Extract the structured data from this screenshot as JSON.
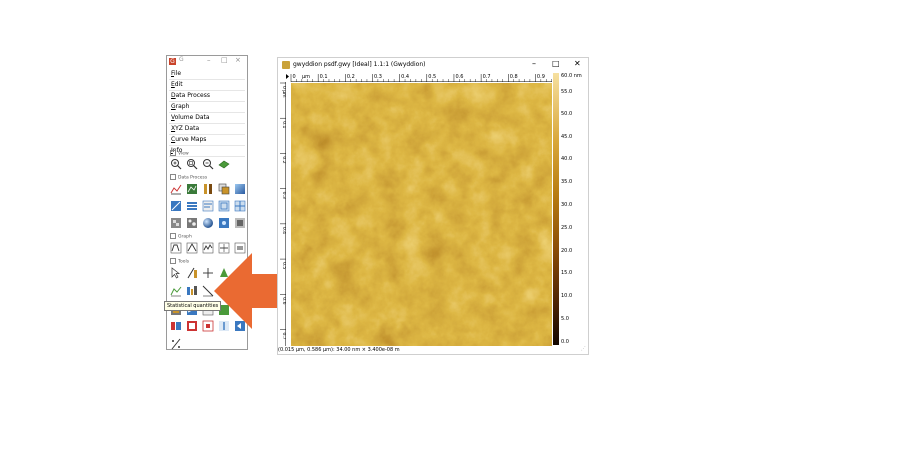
{
  "toolbox": {
    "app_icon": "gwyddion-logo-icon",
    "title": "G",
    "controls": [
      "–",
      "□",
      "×"
    ],
    "menu": [
      {
        "label": "File"
      },
      {
        "label": "Edit"
      },
      {
        "label": "Data Process"
      },
      {
        "label": "Graph"
      },
      {
        "label": "Volume Data"
      },
      {
        "label": "XYZ Data"
      },
      {
        "label": "Curve Maps"
      },
      {
        "label": "Info"
      }
    ],
    "sections": {
      "view": "View",
      "data_process": "Data Process",
      "graph": "Graph",
      "tools": "Tools"
    },
    "tooltip": "Statistical quantities"
  },
  "image_window": {
    "title": "gwyddion psdf.gwy [Ideal] 1.1:1 (Gwyddion)",
    "controls": [
      "–",
      "□",
      "✕"
    ],
    "hruler": {
      "unit": "μm",
      "ticks": [
        "0",
        "0.1",
        "0.2",
        "0.3",
        "0.4",
        "0.5",
        "0.6",
        "0.7",
        "0.8",
        "0.9"
      ]
    },
    "vruler": {
      "unit": "μm",
      "ticks": [
        "0",
        "0.1",
        "0.2",
        "0.3",
        "0.4",
        "0.5",
        "0.6",
        "0.7"
      ]
    },
    "colorbar": {
      "max_label": "60.0 nm",
      "labels": [
        "55.0",
        "50.0",
        "45.0",
        "40.0",
        "35.0",
        "30.0",
        "25.0",
        "20.0",
        "15.0",
        "10.0",
        "5.0",
        "0.0"
      ]
    },
    "status": "(0.015 μm, 0.586 μm): 34.00 nm × 3.400e-08 m"
  },
  "colors": {
    "arrow": "#ea6a32",
    "surface_dark": "#4b2204",
    "surface_light": "#f6e0a0"
  }
}
